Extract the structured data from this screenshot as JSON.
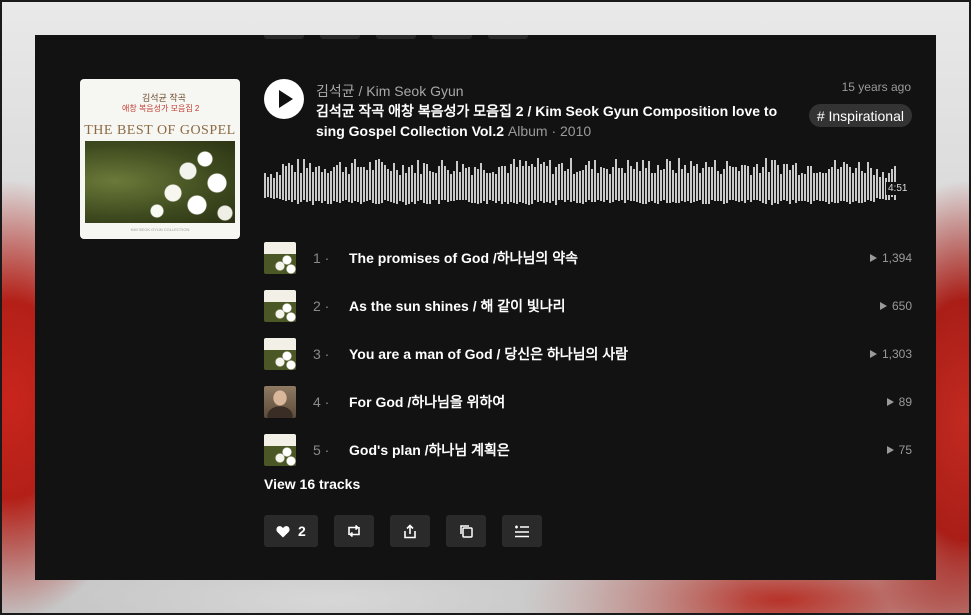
{
  "playlist": {
    "artist": "김석균 / Kim Seok Gyun",
    "title": "김석균 작곡 애창 복음성가 모음집 2 / Kim Seok Gyun Composition love to sing Gospel Collection Vol.2",
    "meta": "Album · 2010",
    "posted": "15 years ago",
    "tag": "# Inspirational",
    "duration": "4:51",
    "cover": {
      "korean_line1": "김석균 작곡",
      "korean_line2": "애창 복음성가 모음집 2",
      "headline": "THE BEST OF GOSPEL",
      "footer": "KIM SEOK GYUN COLLECTION"
    }
  },
  "tracks": [
    {
      "number": "1",
      "title": "The promises of God /하나님의 약속",
      "plays": "1,394",
      "thumb": "flowers"
    },
    {
      "number": "2",
      "title": "As the sun shines / 해 같이 빛나리",
      "plays": "650",
      "thumb": "flowers"
    },
    {
      "number": "3",
      "title": "You are a man of God / 당신은 하나님의 사람",
      "plays": "1,303",
      "thumb": "flowers"
    },
    {
      "number": "4",
      "title": "For God /하나님을 위하여",
      "plays": "89",
      "thumb": "portrait"
    },
    {
      "number": "5",
      "title": "God's plan /하나님 계획은",
      "plays": "75",
      "thumb": "flowers"
    }
  ],
  "view_all_label": "View 16 tracks",
  "actions": {
    "like_count": "2"
  },
  "colors": {
    "panel_bg": "#121212",
    "waveform": "#c9c9c9",
    "muted_text": "#9a9a9a",
    "button_bg": "#2a2a2a"
  }
}
